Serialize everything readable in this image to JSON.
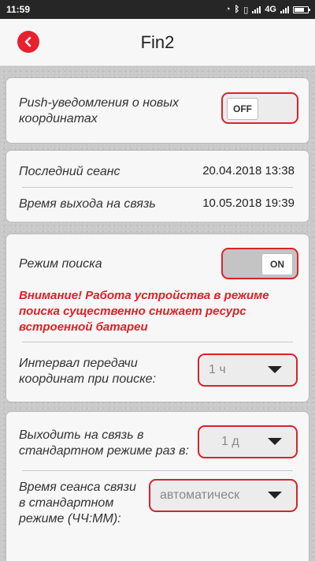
{
  "status_bar": {
    "time": "11:59",
    "network": "4G"
  },
  "header": {
    "title": "Fin2",
    "back_icon": "chevron-left-icon",
    "accent_color": "#e8212e"
  },
  "push_section": {
    "label": "Push-уведомления о новых координатах",
    "toggle_state": "OFF"
  },
  "session_section": {
    "last_session_label": "Последний сеанс",
    "last_session_value": "20.04.2018 13:38",
    "connect_time_label": "Время выхода на связь",
    "connect_time_value": "10.05.2018 19:39"
  },
  "search_section": {
    "mode_label": "Режим поиска",
    "toggle_state": "ON",
    "warning": "Внимание! Работа устройства в режиме поиска существенно снижает ресурс встроенной батареи",
    "interval_label": "Интервал передачи координат при поиске:",
    "interval_value": "1 ч"
  },
  "standard_section": {
    "frequency_label": "Выходить на связь в стандартном режиме раз в:",
    "frequency_value": "1 д",
    "session_time_label": "Время сеанса связи в стандартном режиме (ЧЧ:ММ):",
    "session_time_value": "автоматическ"
  }
}
